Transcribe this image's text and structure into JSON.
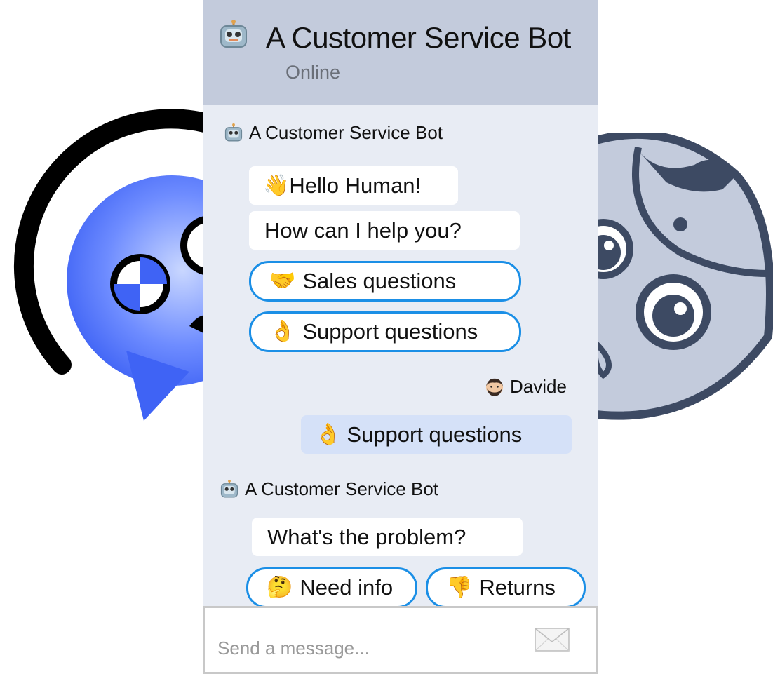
{
  "header": {
    "title": "A Customer Service Bot",
    "status": "Online"
  },
  "messages": [
    {
      "sender": "A Customer Service Bot",
      "bubbles": [
        "Hello Human!",
        "How can I help you?"
      ],
      "choices": [
        "Sales questions",
        "Support questions"
      ]
    },
    {
      "sender": "Davide",
      "bubbles": [
        "Support questions"
      ]
    },
    {
      "sender": "A Customer Service Bot",
      "bubbles": [
        "What's the problem?"
      ],
      "choices": [
        "Need info",
        "Returns"
      ]
    }
  ],
  "composer": {
    "placeholder": "Send a message..."
  },
  "colors": {
    "header_bg": "#c3cbdc",
    "chat_bg": "#e8ecf4",
    "choice_border": "#1b8fe6",
    "user_bubble": "#d5e1f8"
  },
  "icons": {
    "bot_avatar": "robot-icon",
    "user_avatar": "man-beard-icon",
    "wave": "waving-hand-icon",
    "sales": "handshake-icon",
    "support": "ok-hand-icon",
    "need_info": "thinking-face-icon",
    "returns": "thumbs-down-icon",
    "send": "envelope-icon"
  }
}
